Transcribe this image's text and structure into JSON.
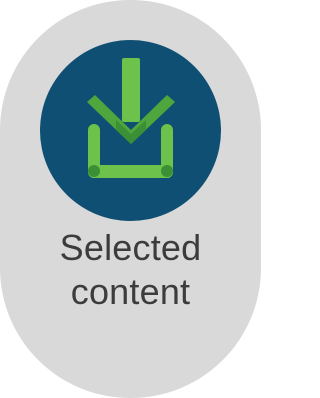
{
  "tile": {
    "label_line1": "Selected",
    "label_line2": "content",
    "icon": "download-icon",
    "colors": {
      "tile_bg": "#d9d9d9",
      "circle_bg": "#0f4f73",
      "icon_green": "#6cc24a",
      "icon_dark_green": "#3b8f34",
      "text": "#3c3c3c"
    }
  }
}
